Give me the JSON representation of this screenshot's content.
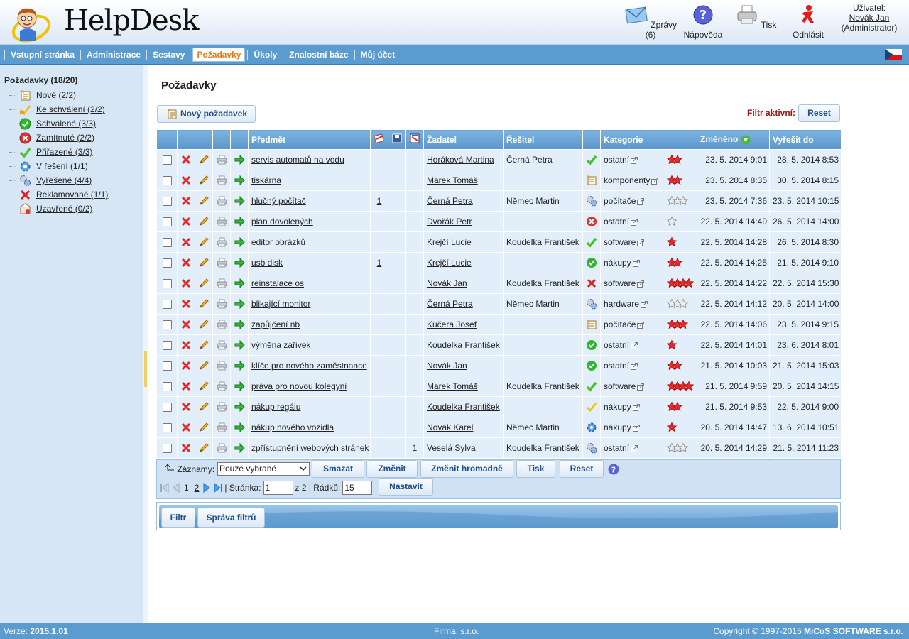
{
  "app": {
    "title": "HelpDesk"
  },
  "header": {
    "messages_label": "Zprávy (6)",
    "help_label": "Nápověda",
    "print_label": "Tisk",
    "logout_label": "Odhlásit",
    "user_label": "Uživatel:",
    "user_name": "Novák Jan",
    "user_role": "(Administrator)"
  },
  "nav": {
    "items": [
      "Vstupní stránka",
      "Administrace",
      "Sestavy",
      "Požadavky",
      "Úkoly",
      "Znalostní báze",
      "Můj účet"
    ],
    "active": "Požadavky"
  },
  "sidebar": {
    "title": "Požadavky (18/20)",
    "items": [
      {
        "label": "Nové (2/2)",
        "icon": "new-note-icon"
      },
      {
        "label": "Ke schválení (2/2)",
        "icon": "pending-check-icon"
      },
      {
        "label": "Schválené (3/3)",
        "icon": "approved-icon"
      },
      {
        "label": "Zamítnuté (2/2)",
        "icon": "rejected-icon"
      },
      {
        "label": "Přiřazené (3/3)",
        "icon": "assigned-check-icon"
      },
      {
        "label": "V řešení (1/1)",
        "icon": "gear-icon"
      },
      {
        "label": "Vyřešené (4/4)",
        "icon": "gears-icon"
      },
      {
        "label": "Reklamované (1/1)",
        "icon": "red-cross-icon"
      },
      {
        "label": "Uzavřené (0/2)",
        "icon": "closed-box-icon"
      }
    ]
  },
  "main": {
    "title": "Požadavky",
    "new_button": "Nový požadavek",
    "filter_active_label": "Filtr aktivní:",
    "reset_label": "Reset"
  },
  "table": {
    "headers": {
      "subject": "Předmět",
      "requester": "Žadatel",
      "solver": "Řešitel",
      "category": "Kategorie",
      "changed": "Změněno",
      "due": "Vyřešit do"
    },
    "rows": [
      {
        "subject": "servis automatů na vodu",
        "c1": "",
        "c3": "",
        "requester": "Horáková Martina",
        "solver": "Černá Petra",
        "status": "assigned",
        "category": "ostatní",
        "priority": 2,
        "changed": "23. 5. 2014 9:01",
        "due": "28. 5. 2014 8:53"
      },
      {
        "subject": "tiskárna",
        "c1": "",
        "c3": "",
        "requester": "Marek Tomáš",
        "solver": "",
        "status": "new",
        "category": "komponenty",
        "priority": 2,
        "changed": "23. 5. 2014 8:35",
        "due": "30. 5. 2014 8:15"
      },
      {
        "subject": "hlučný počítač",
        "c1": "1",
        "c3": "",
        "requester": "Černá Petra",
        "solver": "Němec Martin",
        "status": "solved",
        "category": "počítače",
        "priority": 0,
        "changed": "23. 5. 2014 7:36",
        "due": "23. 5. 2014 10:15"
      },
      {
        "subject": "plán dovolených",
        "c1": "",
        "c3": "",
        "requester": "Dvořák Petr",
        "solver": "",
        "status": "rejected",
        "category": "ostatní",
        "priority": -1,
        "changed": "22. 5. 2014 14:49",
        "due": "26. 5. 2014 14:00"
      },
      {
        "subject": "editor obrázků",
        "c1": "",
        "c3": "",
        "requester": "Krejčí Lucie",
        "solver": "Koudelka František",
        "status": "assigned",
        "category": "software",
        "priority": 1,
        "changed": "22. 5. 2014 14:28",
        "due": "26. 5. 2014 8:30"
      },
      {
        "subject": "usb disk",
        "c1": "1",
        "c3": "",
        "requester": "Krejčí Lucie",
        "solver": "",
        "status": "approved",
        "category": "nákupy",
        "priority": 2,
        "changed": "22. 5. 2014 14:25",
        "due": "21. 5. 2014 9:10"
      },
      {
        "subject": "reinstalace os",
        "c1": "",
        "c3": "",
        "requester": "Novák Jan",
        "solver": "Koudelka František",
        "status": "claimed",
        "category": "software",
        "priority": 4,
        "changed": "22. 5. 2014 14:22",
        "due": "22. 5. 2014 15:30"
      },
      {
        "subject": "blikající monitor",
        "c1": "",
        "c3": "",
        "requester": "Černá Petra",
        "solver": "Němec Martin",
        "status": "solved",
        "category": "hardware",
        "priority": 0,
        "changed": "22. 5. 2014 14:12",
        "due": "20. 5. 2014 14:00"
      },
      {
        "subject": "zapůjčení nb",
        "c1": "",
        "c3": "",
        "requester": "Kučera Josef",
        "solver": "",
        "status": "new",
        "category": "počítače",
        "priority": 3,
        "changed": "22. 5. 2014 14:06",
        "due": "23. 5. 2014 9:15"
      },
      {
        "subject": "výměna zářivek",
        "c1": "",
        "c3": "",
        "requester": "Koudelka František",
        "solver": "",
        "status": "approved",
        "category": "ostatní",
        "priority": 1,
        "changed": "22. 5. 2014 14:01",
        "due": "23. 6. 2014 8:01"
      },
      {
        "subject": "klíče pro nového zaměstnance",
        "c1": "",
        "c3": "",
        "requester": "Novák Jan",
        "solver": "",
        "status": "approved",
        "category": "ostatní",
        "priority": 2,
        "changed": "21. 5. 2014 10:03",
        "due": "21. 5. 2014 15:03"
      },
      {
        "subject": "práva pro novou kolegyni",
        "c1": "",
        "c3": "",
        "requester": "Marek Tomáš",
        "solver": "Koudelka František",
        "status": "assigned",
        "category": "software",
        "priority": 4,
        "changed": "21. 5. 2014 9:59",
        "due": "20. 5. 2014 14:15"
      },
      {
        "subject": "nákup regálu",
        "c1": "",
        "c3": "",
        "requester": "Koudelka František",
        "solver": "",
        "status": "pending",
        "category": "nákupy",
        "priority": 2,
        "changed": "21. 5. 2014 9:53",
        "due": "22. 5. 2014 9:00"
      },
      {
        "subject": "nákup nového vozidla",
        "c1": "",
        "c3": "",
        "requester": "Novák Karel",
        "solver": "Němec Martin",
        "status": "inprogress",
        "category": "nákupy",
        "priority": 1,
        "changed": "20. 5. 2014 14:47",
        "due": "13. 6. 2014 10:51"
      },
      {
        "subject": "zpřístupnění webových stránek",
        "c1": "",
        "c3": "1",
        "requester": "Veselá Sylva",
        "solver": "Koudelka František",
        "status": "solved",
        "category": "ostatní",
        "priority": 0,
        "changed": "20. 5. 2014 14:29",
        "due": "21. 5. 2014 11:23"
      }
    ]
  },
  "footer": {
    "records_label": "Záznamy:",
    "records_option": "Pouze vybrané",
    "buttons": [
      "Smazat",
      "Změnit",
      "Změnit hromadně",
      "Tisk",
      "Reset"
    ],
    "pager_page1": "1",
    "pager_page2": "2",
    "page_label": "| Stránka:",
    "page_value": "1",
    "of_label": "z 2 | Řádků:",
    "rows_value": "15",
    "set_label": "Nastavit"
  },
  "filter_tabs": [
    "Filtr",
    "Správa filtrů"
  ],
  "status_bar": {
    "version_label": "Verze:",
    "version": "2015.1.01",
    "company": "Firma, s.r.o.",
    "copyright_prefix": "Copyright © 1997-2015",
    "copyright_brand": "MiCoS SOFTWARE s.r.o."
  }
}
